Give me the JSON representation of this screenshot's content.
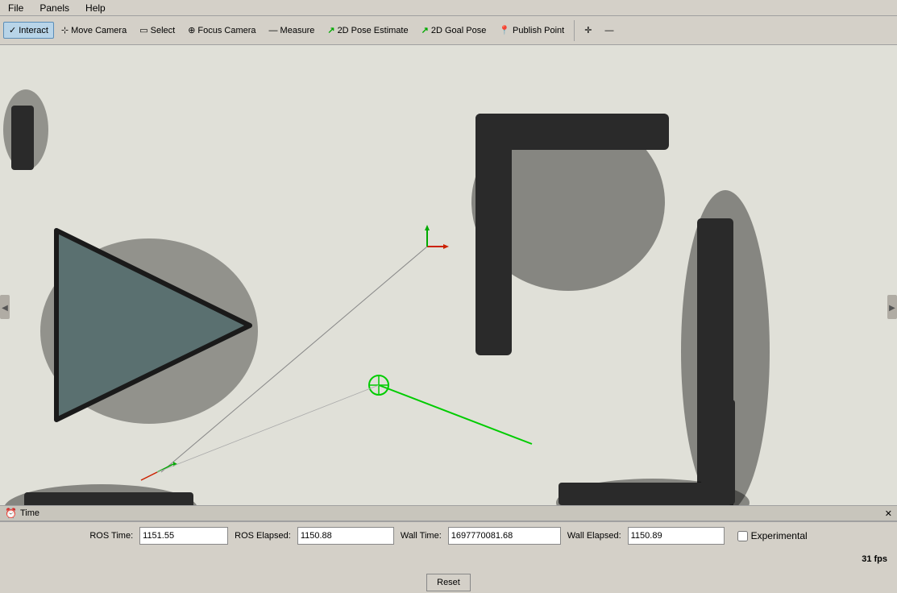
{
  "menubar": {
    "items": [
      "File",
      "Panels",
      "Help"
    ]
  },
  "toolbar": {
    "buttons": [
      {
        "id": "interact",
        "label": "Interact",
        "icon": "cursor",
        "active": true
      },
      {
        "id": "move-camera",
        "label": "Move Camera",
        "icon": "move",
        "active": false
      },
      {
        "id": "select",
        "label": "Select",
        "icon": "select",
        "active": false
      },
      {
        "id": "focus-camera",
        "label": "Focus Camera",
        "icon": "focus",
        "active": false
      },
      {
        "id": "measure",
        "label": "Measure",
        "icon": "ruler",
        "active": false
      },
      {
        "id": "pose-estimate",
        "label": "2D Pose Estimate",
        "icon": "arrow-green",
        "active": false
      },
      {
        "id": "goal-pose",
        "label": "2D Goal Pose",
        "icon": "arrow-green2",
        "active": false
      },
      {
        "id": "publish-point",
        "label": "Publish Point",
        "icon": "pin-red",
        "active": false
      }
    ],
    "zoom_in": "+",
    "zoom_out": "−"
  },
  "statusbar": {
    "label": "Time"
  },
  "fields": {
    "ros_time_label": "ROS Time:",
    "ros_time_value": "1151.55",
    "ros_elapsed_label": "ROS Elapsed:",
    "ros_elapsed_value": "1150.88",
    "wall_time_label": "Wall Time:",
    "wall_time_value": "1697770081.68",
    "wall_elapsed_label": "Wall Elapsed:",
    "wall_elapsed_value": "1150.89"
  },
  "controls": {
    "experimental_label": "Experimental",
    "reset_label": "Reset",
    "fps": "31 fps"
  },
  "colors": {
    "bg": "#e0e0d8",
    "wall": "#2a2a2a",
    "wall_shadow": "#888888",
    "robot_fill": "#5a7070",
    "robot_border": "#1a1a1a",
    "axis_red": "#cc2200",
    "axis_green": "#00aa00",
    "pose_green": "#00cc00",
    "crosshair_green": "#00bb00"
  }
}
